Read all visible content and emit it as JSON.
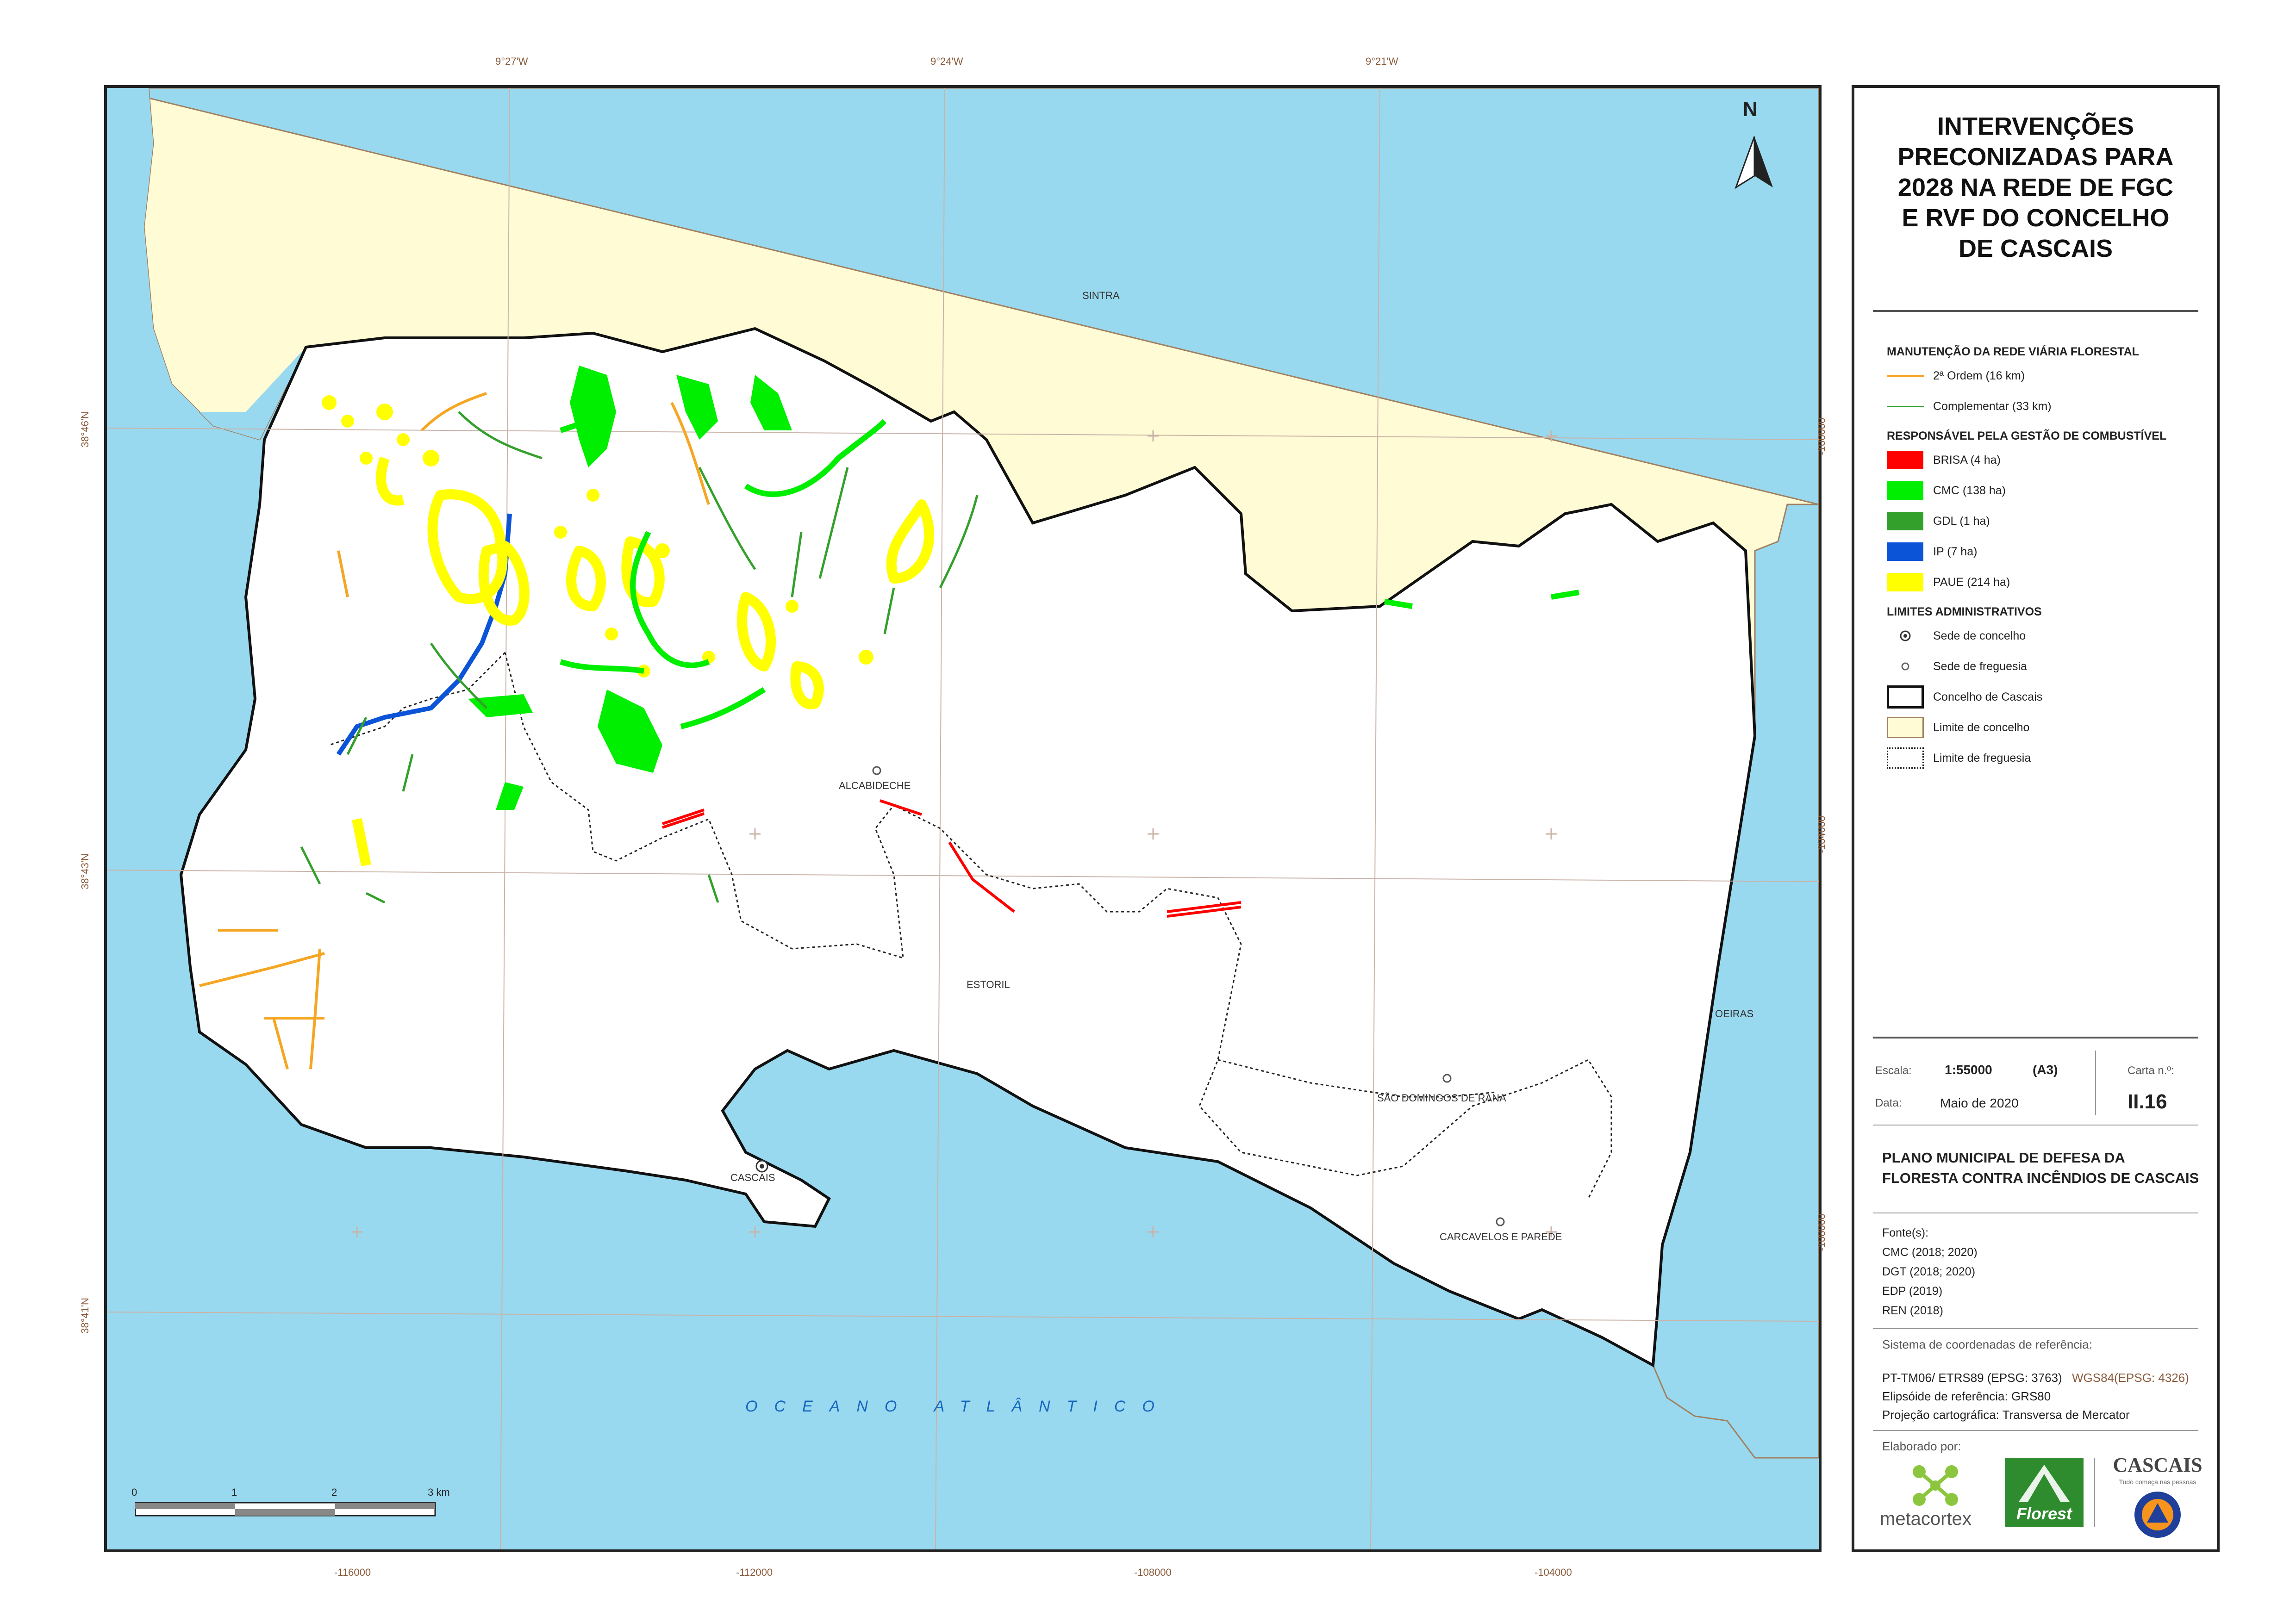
{
  "title": "INTERVENÇÕES PRECONIZADAS PARA 2028 NA REDE DE FGC E RVF DO CONCELHO DE CASCAIS",
  "title_lines": [
    "INTERVENÇÕES",
    "PRECONIZADAS PARA",
    "2028 NA REDE DE FGC",
    "E RVF DO CONCELHO",
    "DE CASCAIS"
  ],
  "north_label": "N",
  "graticule": {
    "longitudes": [
      "9°27'W",
      "9°24'W",
      "9°21'W"
    ],
    "latitudes": [
      "38°46'N",
      "38°43'N",
      "38°41'N"
    ],
    "eastings": [
      "-116000",
      "-112000",
      "-108000",
      "-104000"
    ],
    "northings": [
      "-100000",
      "-104000",
      "-108000"
    ]
  },
  "map_labels": {
    "sintra": "SINTRA",
    "oeiras": "OEIRAS",
    "alcabideche": "ALCABIDECHE",
    "estoril": "ESTORIL",
    "sao_domingos": "SÃO DOMINGOS DE RANA",
    "cascais": "CASCAIS",
    "carcavelos": "CARCAVELOS E PAREDE",
    "ocean": "OCEANO ATLÂNTICO"
  },
  "scale_bar": {
    "ticks": [
      "0",
      "1",
      "2",
      "3 km"
    ]
  },
  "legend": {
    "road_heading": "MANUTENÇÃO DA REDE VIÁRIA FLORESTAL",
    "road_items": [
      {
        "label": "2ª Ordem (16 km)",
        "color": "#f5a623"
      },
      {
        "label": "Complementar (33 km)",
        "color": "#2ea02e"
      }
    ],
    "fuel_heading": "RESPONSÁVEL PELA GESTÃO DE COMBUSTÍVEL",
    "fuel_items": [
      {
        "label": "BRISA (4 ha)",
        "color": "#ff0000"
      },
      {
        "label": "CMC (138 ha)",
        "color": "#00ee00"
      },
      {
        "label": "GDL (1 ha)",
        "color": "#33a02c"
      },
      {
        "label": "IP (7 ha)",
        "color": "#0b54d8"
      },
      {
        "label": "PAUE (214 ha)",
        "color": "#ffff00"
      }
    ],
    "admin_heading": "LIMITES ADMINISTRATIVOS",
    "admin_items": [
      {
        "label": "Sede de concelho",
        "symbol": "dot-circle-icon"
      },
      {
        "label": "Sede de freguesia",
        "symbol": "small-circle-icon"
      },
      {
        "label": "Concelho de Cascais",
        "symbol": "black-outline-box"
      },
      {
        "label": "Limite de concelho",
        "symbol": "beige-box"
      },
      {
        "label": "Limite de freguesia",
        "symbol": "dotted-box"
      }
    ]
  },
  "colors": {
    "sea": "#99d9ef",
    "neighbour_land": "#fffbd5",
    "municipality": "#ffffff",
    "graticule": "#c9b3a8"
  },
  "meta": {
    "scale_label": "Escala:",
    "scale_value": "1:55000",
    "paper": "(A3)",
    "sheet_label": "Carta n.º:",
    "sheet_value": "II.16",
    "date_label": "Data:",
    "date_value": "Maio de 2020"
  },
  "plan_title_lines": [
    "PLANO MUNICIPAL DE DEFESA DA",
    "FLORESTA CONTRA INCÊNDIOS DE CASCAIS"
  ],
  "sources": {
    "label": "Fonte(s):",
    "items": [
      "CMC (2018; 2020)",
      "DGT (2018; 2020)",
      "EDP (2019)",
      "REN (2018)"
    ]
  },
  "reference": {
    "label": "Sistema de coordenadas de referência:",
    "crs": "PT-TM06/ ETRS89 (EPSG: 3763)",
    "crs_alt": "WGS84(EPSG: 4326)",
    "ellipsoid": "Elipsóide de referência: GRS80",
    "projection": "Projeção cartográfica: Transversa de Mercator"
  },
  "credits": {
    "label": "Elaborado por:",
    "metacortex": "metacortex",
    "florest": "Florest",
    "cascais": "CASCAIS",
    "cascais_tagline": "Tudo começa nas pessoas"
  }
}
